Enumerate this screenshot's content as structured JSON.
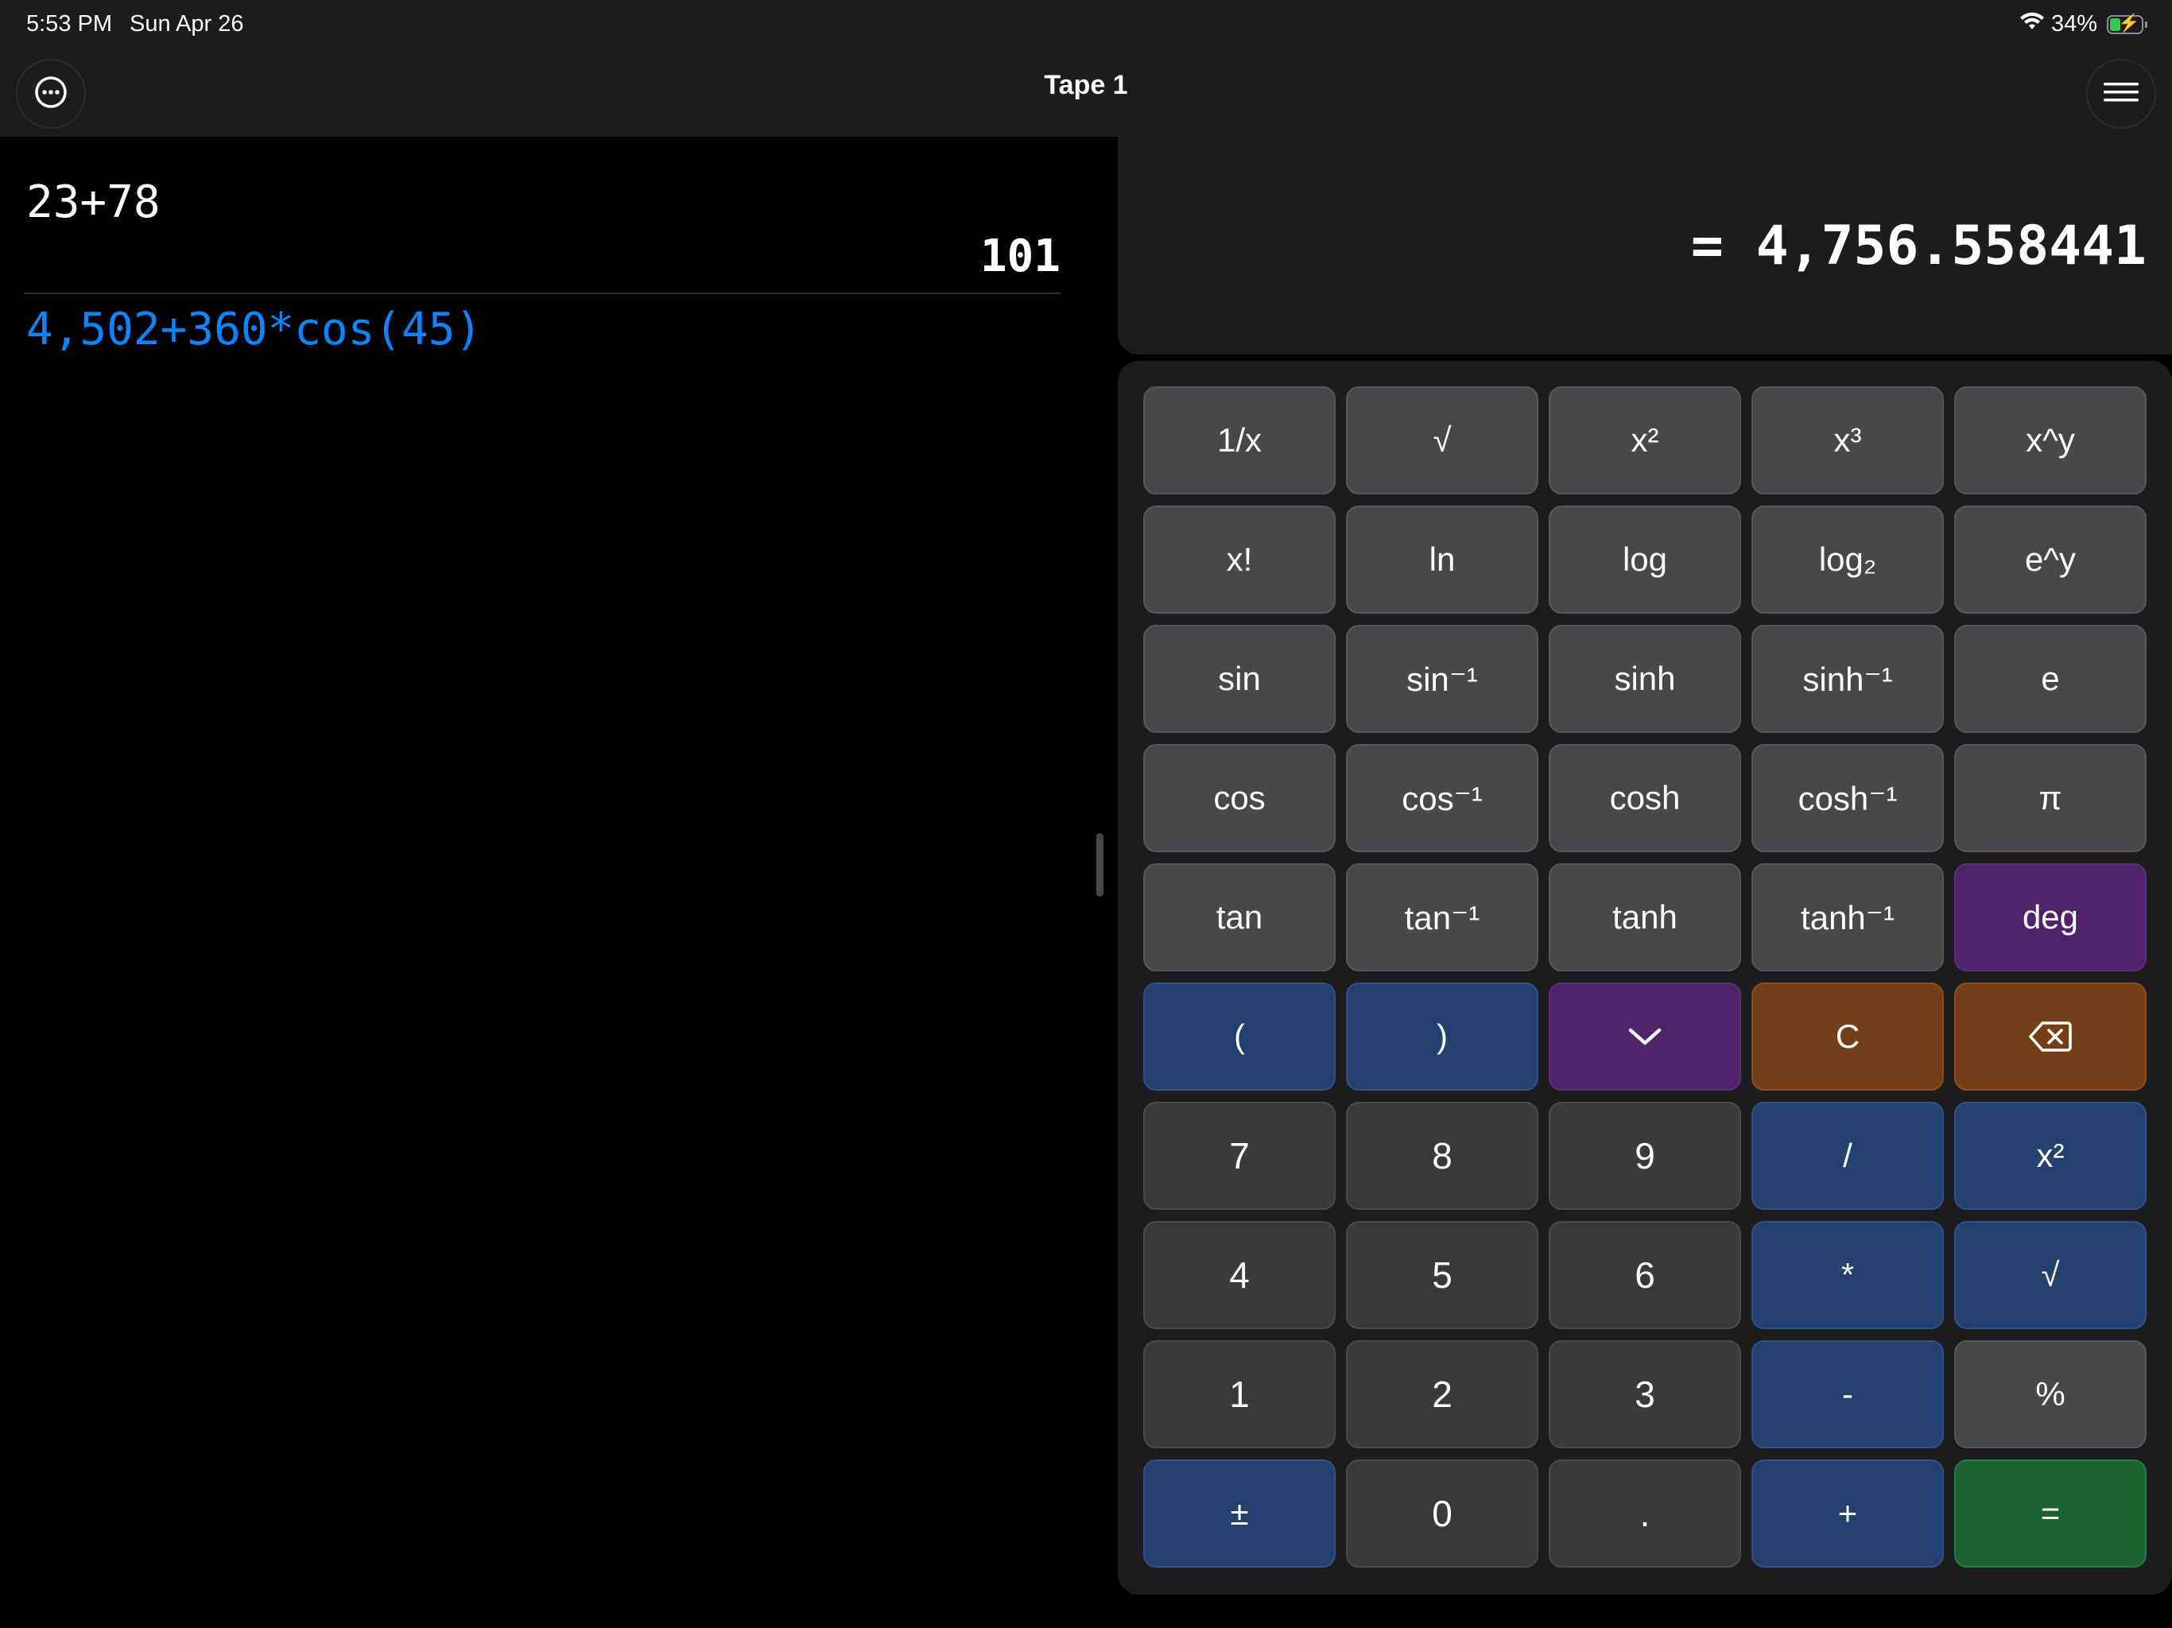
{
  "status": {
    "time": "5:53 PM",
    "date": "Sun Apr 26",
    "battery": "34%",
    "battery_level": 0.34
  },
  "nav": {
    "title": "Tape 1"
  },
  "tape": {
    "previous_expression": "23+78",
    "previous_result": "101",
    "current_expression": "4,502+360*cos(45)"
  },
  "display": {
    "value": "= 4,756.558441"
  },
  "keys": {
    "r1": [
      "1/x",
      "√",
      "x²",
      "x³",
      "x^y"
    ],
    "r2": [
      "x!",
      "ln",
      "log",
      "log₂",
      "e^y"
    ],
    "r3": [
      "sin",
      "sin⁻¹",
      "sinh",
      "sinh⁻¹",
      "e"
    ],
    "r4": [
      "cos",
      "cos⁻¹",
      "cosh",
      "cosh⁻¹",
      "π"
    ],
    "r5": [
      "tan",
      "tan⁻¹",
      "tanh",
      "tanh⁻¹",
      "deg"
    ],
    "r6": [
      "(",
      ")",
      "",
      "C",
      ""
    ],
    "r7": [
      "7",
      "8",
      "9",
      "/",
      "x²"
    ],
    "r8": [
      "4",
      "5",
      "6",
      "*",
      "√"
    ],
    "r9": [
      "1",
      "2",
      "3",
      "-",
      "%"
    ],
    "r10": [
      "±",
      "0",
      ".",
      "+",
      "="
    ]
  },
  "icons": {
    "more": "ellipsis-circle-icon",
    "menu": "hamburger-menu-icon",
    "collapse": "chevron-down-icon",
    "backspace": "backspace-icon",
    "wifi": "wifi-icon",
    "battery": "battery-charging-icon"
  },
  "colors": {
    "tape_current": "#0a84ff",
    "blue_key": "#23406e",
    "purple_key": "#4e2369",
    "orange_key": "#733f19",
    "green_key": "#1b6431"
  }
}
